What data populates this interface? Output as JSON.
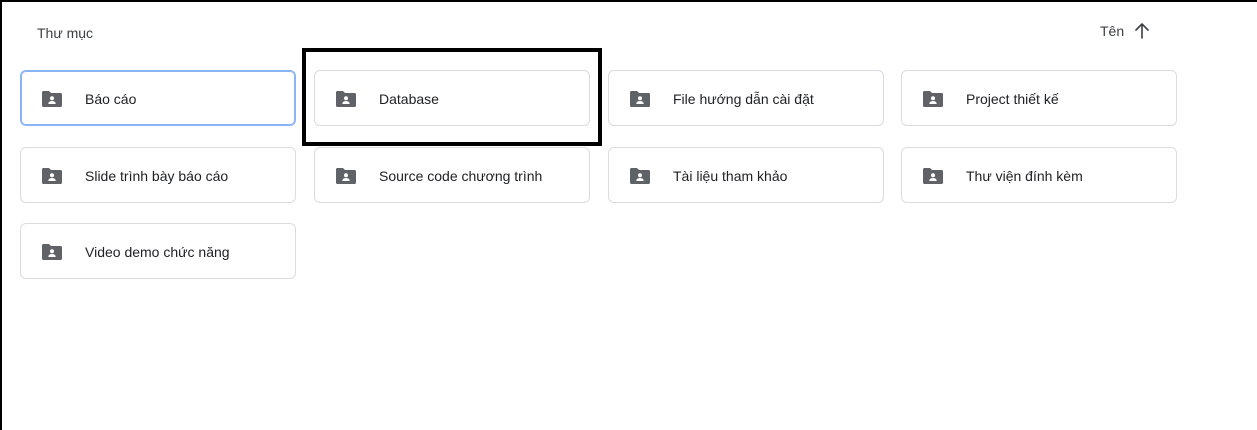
{
  "section": {
    "title": "Thư mục"
  },
  "sort": {
    "label": "Tên",
    "direction": "ascending"
  },
  "folders": [
    {
      "label": "Báo cáo",
      "selected": true
    },
    {
      "label": "Database",
      "selected": false
    },
    {
      "label": "File hướng dẫn cài đặt",
      "selected": false
    },
    {
      "label": "Project thiết kế",
      "selected": false
    },
    {
      "label": "Slide trình bày báo cáo",
      "selected": false
    },
    {
      "label": "Source code chương trình",
      "selected": false
    },
    {
      "label": "Tài liệu tham khảo",
      "selected": false
    },
    {
      "label": "Thư viện đính kèm",
      "selected": false
    },
    {
      "label": "Video demo chức năng",
      "selected": false
    }
  ],
  "icons": {
    "folder": "shared-folder-icon",
    "sort": "arrow-up-icon"
  },
  "colors": {
    "icon": "#5f6368",
    "border": "#dadce0",
    "selected_border": "#8ab4f8",
    "annotation": "#000000"
  }
}
